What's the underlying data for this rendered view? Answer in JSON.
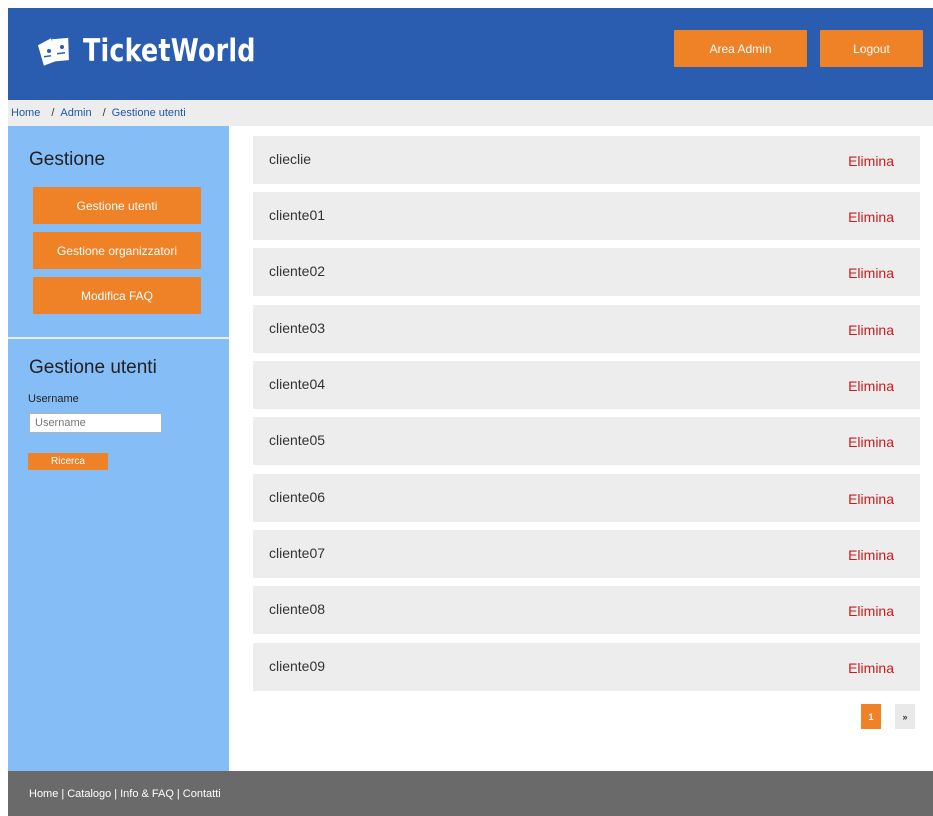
{
  "header": {
    "logo_text": "TicketWorld",
    "buttons": {
      "admin": "Area Admin",
      "logout": "Logout"
    }
  },
  "breadcrumb": {
    "items": [
      "Home",
      "Admin",
      "Gestione utenti"
    ],
    "separator": "/"
  },
  "sidebar": {
    "section_title": "Gestione",
    "nav_buttons": [
      "Gestione utenti",
      "Gestione organizzatori",
      "Modifica FAQ"
    ],
    "search": {
      "title": "Gestione utenti",
      "label": "Username",
      "placeholder": "Username",
      "button": "Ricerca"
    }
  },
  "users": [
    {
      "name": "clieclie",
      "action": "Elimina"
    },
    {
      "name": "cliente01",
      "action": "Elimina"
    },
    {
      "name": "cliente02",
      "action": "Elimina"
    },
    {
      "name": "cliente03",
      "action": "Elimina"
    },
    {
      "name": "cliente04",
      "action": "Elimina"
    },
    {
      "name": "cliente05",
      "action": "Elimina"
    },
    {
      "name": "cliente06",
      "action": "Elimina"
    },
    {
      "name": "cliente07",
      "action": "Elimina"
    },
    {
      "name": "cliente08",
      "action": "Elimina"
    },
    {
      "name": "cliente09",
      "action": "Elimina"
    }
  ],
  "pagination": {
    "current": "1",
    "next": "»"
  },
  "footer": {
    "links": [
      "Home",
      "Catalogo",
      "Info & FAQ",
      "Contatti"
    ],
    "separator": "|"
  },
  "colors": {
    "header_blue": "#2a5db0",
    "sidebar_blue": "#85bdf7",
    "accent_orange": "#ef8127",
    "delete_red": "#cc1b1b",
    "footer_gray": "#6a6a6a"
  },
  "icons": {
    "logo": "tickets-icon"
  }
}
